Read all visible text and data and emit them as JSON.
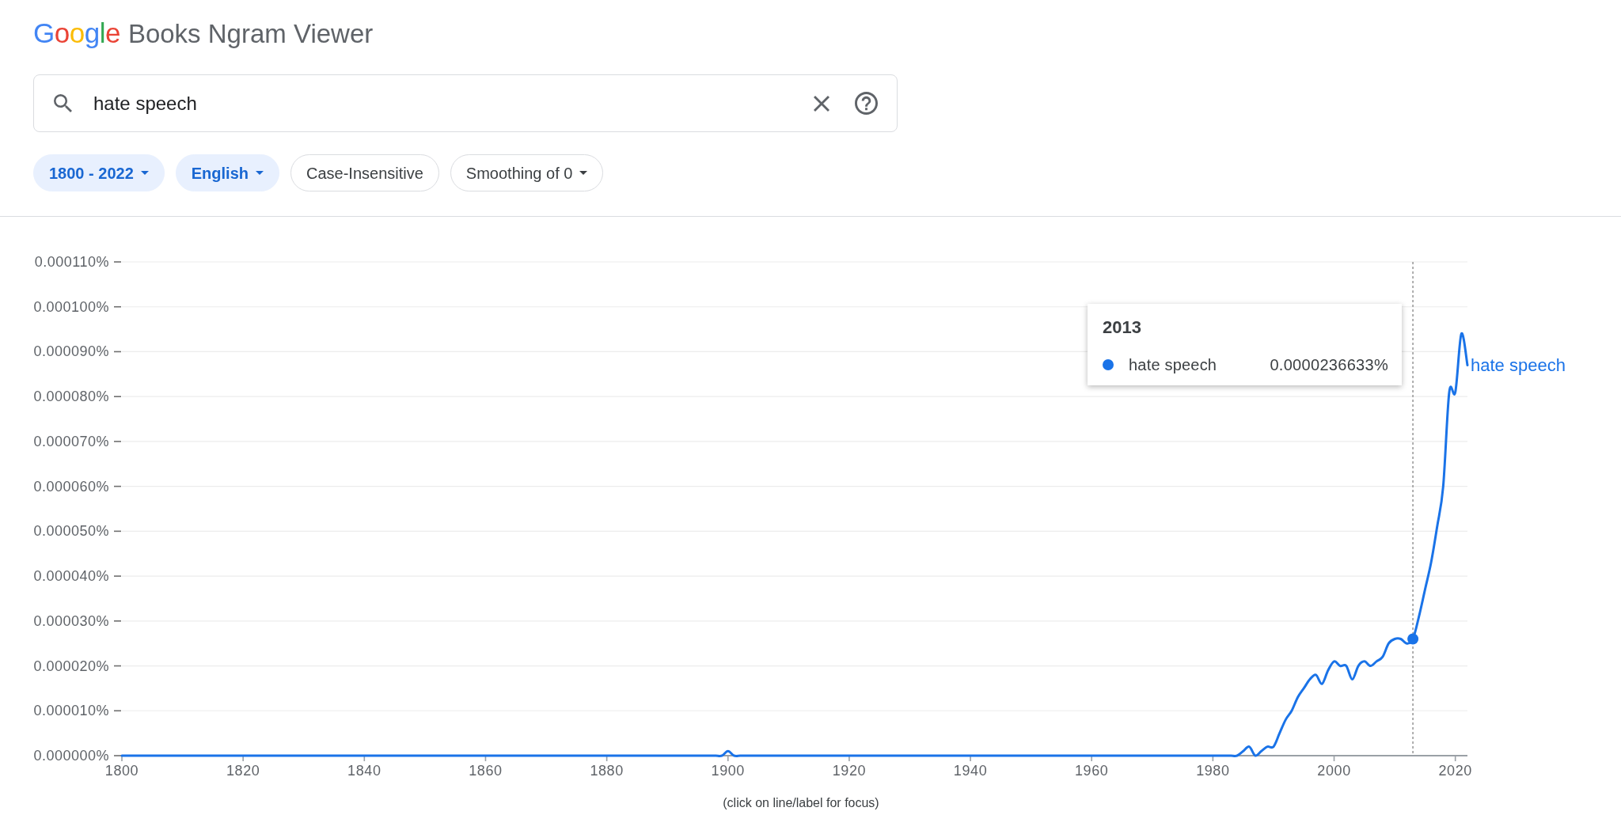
{
  "logo": {
    "brand": "Google",
    "product": "Books Ngram Viewer"
  },
  "search": {
    "value": "hate speech"
  },
  "filters": [
    {
      "label": "1800 - 2022",
      "active": true,
      "kind": "dropdown"
    },
    {
      "label": "English",
      "active": true,
      "kind": "dropdown"
    },
    {
      "label": "Case-Insensitive",
      "active": false,
      "kind": "toggle"
    },
    {
      "label": "Smoothing of 0",
      "active": false,
      "kind": "dropdown"
    }
  ],
  "chart": {
    "chart_data": {
      "type": "line",
      "x": [
        1800,
        1801,
        1802,
        1803,
        1804,
        1805,
        1806,
        1807,
        1808,
        1809,
        1810,
        1811,
        1812,
        1813,
        1814,
        1815,
        1816,
        1817,
        1818,
        1819,
        1820,
        1821,
        1822,
        1823,
        1824,
        1825,
        1826,
        1827,
        1828,
        1829,
        1830,
        1831,
        1832,
        1833,
        1834,
        1835,
        1836,
        1837,
        1838,
        1839,
        1840,
        1841,
        1842,
        1843,
        1844,
        1845,
        1846,
        1847,
        1848,
        1849,
        1850,
        1851,
        1852,
        1853,
        1854,
        1855,
        1856,
        1857,
        1858,
        1859,
        1860,
        1861,
        1862,
        1863,
        1864,
        1865,
        1866,
        1867,
        1868,
        1869,
        1870,
        1871,
        1872,
        1873,
        1874,
        1875,
        1876,
        1877,
        1878,
        1879,
        1880,
        1881,
        1882,
        1883,
        1884,
        1885,
        1886,
        1887,
        1888,
        1889,
        1890,
        1891,
        1892,
        1893,
        1894,
        1895,
        1896,
        1897,
        1898,
        1899,
        1900,
        1901,
        1902,
        1903,
        1904,
        1905,
        1906,
        1907,
        1908,
        1909,
        1910,
        1911,
        1912,
        1913,
        1914,
        1915,
        1916,
        1917,
        1918,
        1919,
        1920,
        1921,
        1922,
        1923,
        1924,
        1925,
        1926,
        1927,
        1928,
        1929,
        1930,
        1931,
        1932,
        1933,
        1934,
        1935,
        1936,
        1937,
        1938,
        1939,
        1940,
        1941,
        1942,
        1943,
        1944,
        1945,
        1946,
        1947,
        1948,
        1949,
        1950,
        1951,
        1952,
        1953,
        1954,
        1955,
        1956,
        1957,
        1958,
        1959,
        1960,
        1961,
        1962,
        1963,
        1964,
        1965,
        1966,
        1967,
        1968,
        1969,
        1970,
        1971,
        1972,
        1973,
        1974,
        1975,
        1976,
        1977,
        1978,
        1979,
        1980,
        1981,
        1982,
        1983,
        1984,
        1985,
        1986,
        1987,
        1988,
        1989,
        1990,
        1991,
        1992,
        1993,
        1994,
        1995,
        1996,
        1997,
        1998,
        1999,
        2000,
        2001,
        2002,
        2003,
        2004,
        2005,
        2006,
        2007,
        2008,
        2009,
        2010,
        2011,
        2012,
        2013,
        2014,
        2015,
        2016,
        2017,
        2018,
        2019,
        2020,
        2021,
        2022
      ],
      "series": [
        {
          "name": "hate speech",
          "color": "#1a73e8",
          "values": [
            0,
            0,
            0,
            0,
            0,
            0,
            0,
            0,
            0,
            0,
            0,
            0,
            0,
            0,
            0,
            0,
            0,
            0,
            0,
            0,
            0,
            0,
            0,
            0,
            0,
            0,
            0,
            0,
            0,
            0,
            0,
            0,
            0,
            0,
            0,
            0,
            0,
            0,
            0,
            0,
            0,
            0,
            0,
            0,
            0,
            0,
            0,
            0,
            0,
            0,
            0,
            0,
            0,
            0,
            0,
            0,
            0,
            0,
            0,
            0,
            0,
            0,
            0,
            0,
            0,
            0,
            0,
            0,
            0,
            0,
            0,
            0,
            0,
            0,
            0,
            0,
            0,
            0,
            0,
            0,
            0,
            0,
            0,
            0,
            0,
            0,
            0,
            0,
            0,
            0,
            0,
            0,
            0,
            0,
            0,
            0,
            0,
            0,
            0,
            0,
            1e-06,
            0,
            0,
            0,
            0,
            0,
            0,
            0,
            0,
            0,
            0,
            0,
            0,
            0,
            0,
            0,
            0,
            0,
            0,
            0,
            0,
            0,
            0,
            0,
            0,
            0,
            0,
            0,
            0,
            0,
            0,
            0,
            0,
            0,
            0,
            0,
            0,
            0,
            0,
            0,
            0,
            0,
            0,
            0,
            0,
            0,
            0,
            0,
            0,
            0,
            0,
            0,
            0,
            0,
            0,
            0,
            0,
            0,
            0,
            0,
            0,
            0,
            0,
            0,
            0,
            0,
            0,
            0,
            0,
            0,
            0,
            0,
            0,
            0,
            0,
            0,
            0,
            0,
            0,
            0,
            0,
            0,
            0,
            0,
            0,
            1e-06,
            2e-06,
            0,
            1e-06,
            2e-06,
            2e-06,
            5e-06,
            8e-06,
            1e-05,
            1.3e-05,
            1.5e-05,
            1.7e-05,
            1.8e-05,
            1.6e-05,
            1.9e-05,
            2.1e-05,
            2e-05,
            2e-05,
            1.7e-05,
            2e-05,
            2.1e-05,
            2e-05,
            2.1e-05,
            2.2e-05,
            2.5e-05,
            2.6e-05,
            2.6e-05,
            2.5e-05,
            2.6e-05,
            3.1e-05,
            3.7e-05,
            4.3e-05,
            5.1e-05,
            6e-05,
            8.1e-05,
            8.1e-05,
            9.4e-05,
            8.7e-05
          ]
        }
      ],
      "xlim": [
        1800,
        2022
      ],
      "ylim": [
        0,
        0.00011
      ],
      "xticks": [
        1800,
        1820,
        1840,
        1860,
        1880,
        1900,
        1920,
        1940,
        1960,
        1980,
        2000,
        2020
      ],
      "yticks": [
        {
          "value": 0,
          "label": "0.000000%"
        },
        {
          "value": 1e-05,
          "label": "0.000010%"
        },
        {
          "value": 2e-05,
          "label": "0.000020%"
        },
        {
          "value": 3e-05,
          "label": "0.000030%"
        },
        {
          "value": 4e-05,
          "label": "0.000040%"
        },
        {
          "value": 5e-05,
          "label": "0.000050%"
        },
        {
          "value": 6e-05,
          "label": "0.000060%"
        },
        {
          "value": 7e-05,
          "label": "0.000070%"
        },
        {
          "value": 8e-05,
          "label": "0.000080%"
        },
        {
          "value": 9e-05,
          "label": "0.000090%"
        },
        {
          "value": 0.0001,
          "label": "0.000100%"
        },
        {
          "value": 0.00011,
          "label": "0.000110%"
        }
      ],
      "grid": true,
      "ref_lines": [
        {
          "axis": "x",
          "value": 2013
        }
      ]
    },
    "tooltip": {
      "title": "2013",
      "rows": [
        {
          "name": "hate speech",
          "color": "#1a73e8",
          "value": "0.0000236633%"
        }
      ]
    }
  },
  "caption": "(click on line/label for focus)"
}
